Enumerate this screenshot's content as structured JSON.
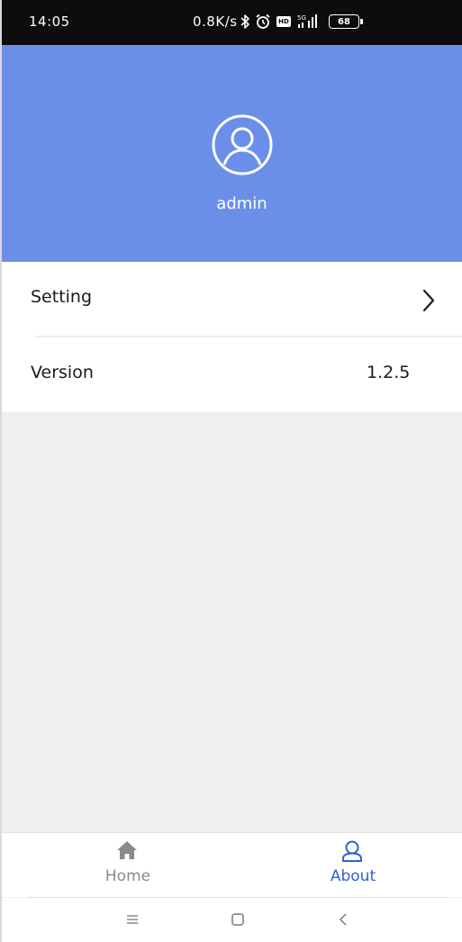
{
  "status_bar": {
    "time": "14:05",
    "net_speed": "0.8K/s",
    "hd_badge": "HD",
    "signal_label": "5G",
    "battery_level": "68",
    "icons": [
      "bluetooth-icon",
      "alarm-icon",
      "hd-icon",
      "signal-icon",
      "battery-icon"
    ]
  },
  "profile": {
    "username": "admin",
    "avatar_icon": "user-avatar-icon",
    "header_color": "#6b8fe8"
  },
  "menu": {
    "items": [
      {
        "label": "Setting",
        "icon": "chevron-right-icon"
      },
      {
        "label": "Version",
        "value": "1.2.5"
      }
    ]
  },
  "tab_bar": {
    "tabs": [
      {
        "label": "Home",
        "icon": "home-icon",
        "active": false
      },
      {
        "label": "About",
        "icon": "user-icon",
        "active": true
      }
    ],
    "active_color": "#2f5fd8",
    "inactive_color": "#8a8a8a"
  },
  "system_nav": {
    "buttons": [
      "menu-icon",
      "home-square-icon",
      "back-icon"
    ]
  }
}
